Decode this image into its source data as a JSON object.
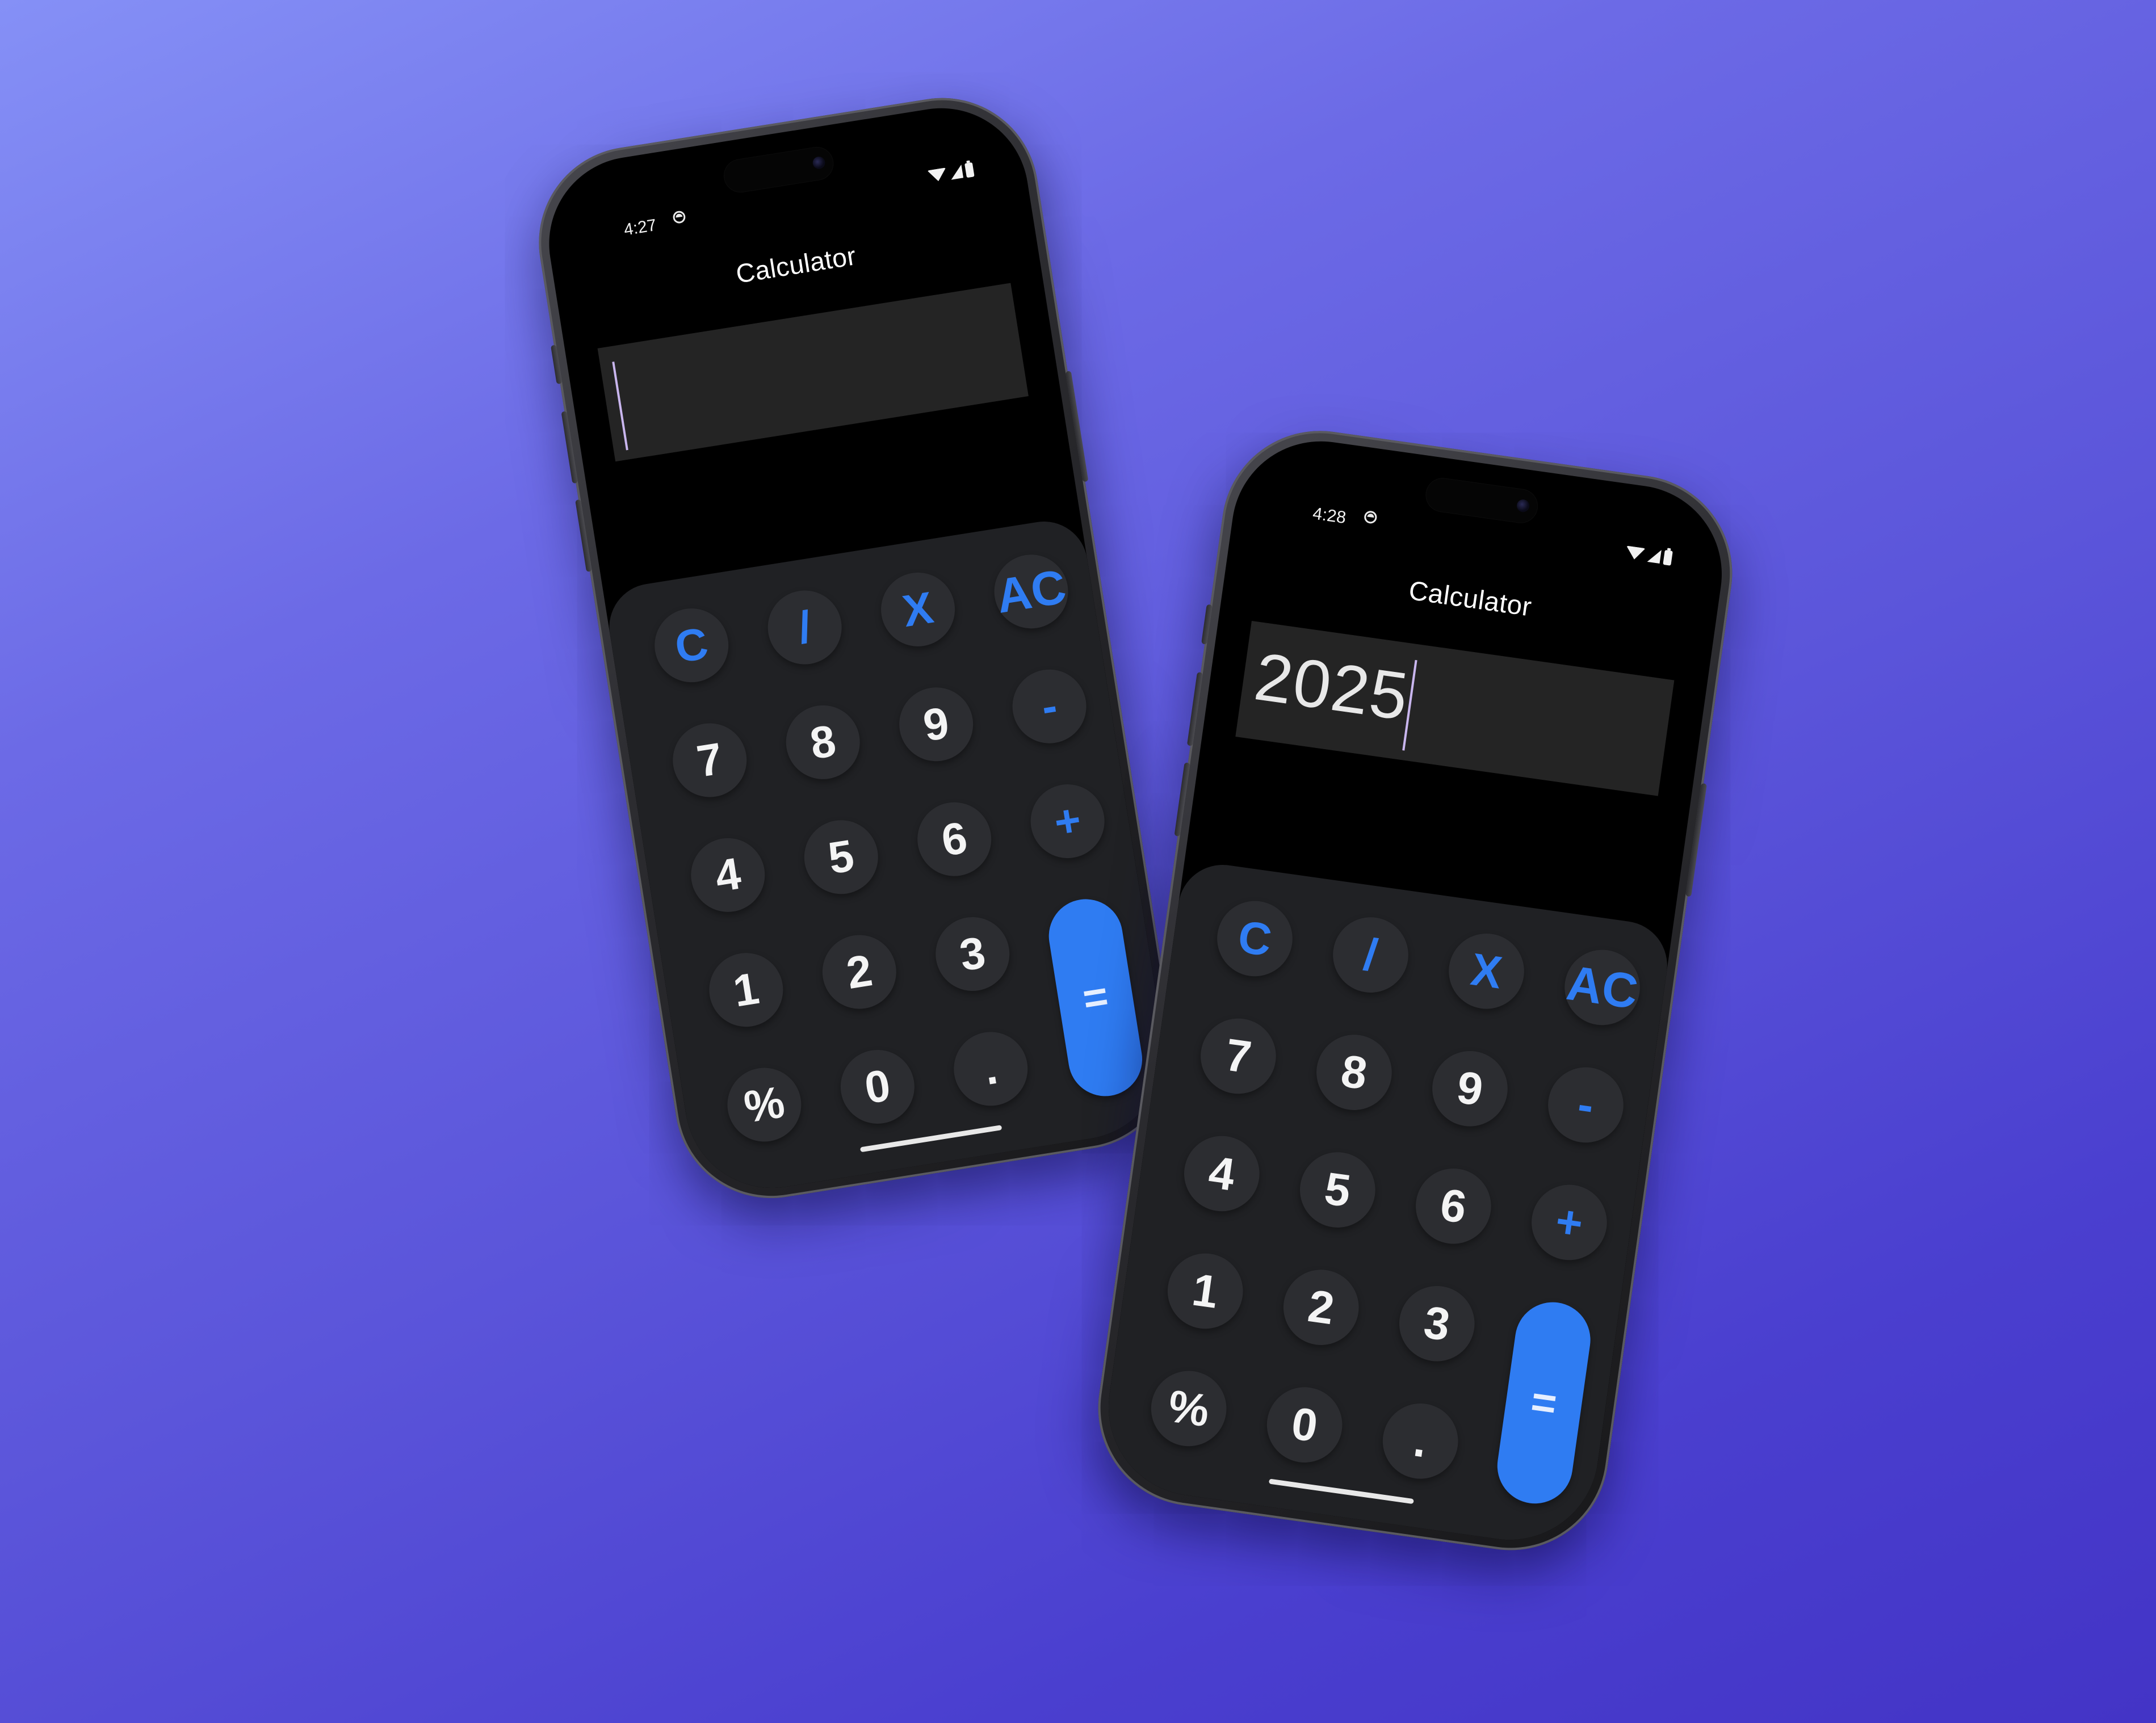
{
  "app": {
    "title": "Calculator",
    "accent_color": "#2f7cf2",
    "keypad_color": "#202124",
    "key_color": "#2c2d31"
  },
  "phones": [
    {
      "status": {
        "time": "4:27",
        "icons": [
          "wifi-icon",
          "cellular-signal-icon",
          "battery-icon"
        ]
      },
      "display": {
        "value": ""
      }
    },
    {
      "status": {
        "time": "4:28",
        "icons": [
          "wifi-icon",
          "cellular-signal-icon",
          "battery-icon"
        ]
      },
      "display": {
        "value": "2025"
      }
    }
  ],
  "keys": {
    "c": "C",
    "divide": "/",
    "multiply": "X",
    "ac": "AC",
    "seven": "7",
    "eight": "8",
    "nine": "9",
    "minus": "-",
    "four": "4",
    "five": "5",
    "six": "6",
    "plus": "+",
    "one": "1",
    "two": "2",
    "three": "3",
    "equals": "=",
    "percent": "%",
    "zero": "0",
    "decimal": "."
  }
}
